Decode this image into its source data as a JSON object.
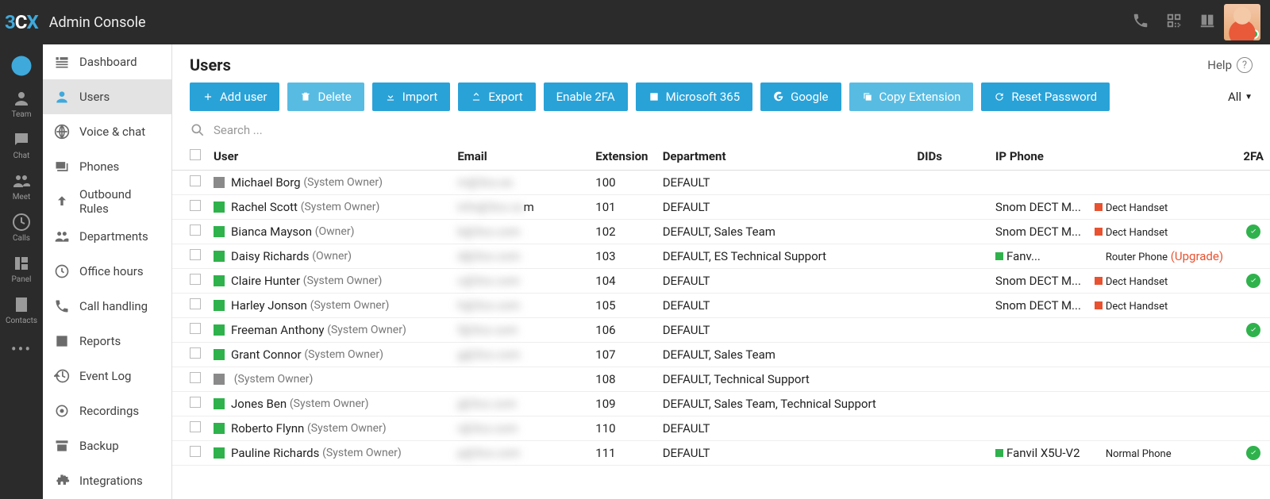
{
  "app": {
    "brand_3": "3",
    "brand_c": "C",
    "brand_x": "X",
    "title": "Admin Console"
  },
  "rail": [
    {
      "id": "chrome",
      "label": ""
    },
    {
      "id": "team",
      "label": "Team"
    },
    {
      "id": "chat",
      "label": "Chat"
    },
    {
      "id": "meet",
      "label": "Meet"
    },
    {
      "id": "calls",
      "label": "Calls"
    },
    {
      "id": "panel",
      "label": "Panel"
    },
    {
      "id": "contacts",
      "label": "Contacts"
    }
  ],
  "sidebar": [
    {
      "id": "dashboard",
      "label": "Dashboard",
      "icon": "dashboard"
    },
    {
      "id": "users",
      "label": "Users",
      "icon": "user",
      "active": true
    },
    {
      "id": "voice",
      "label": "Voice & chat",
      "icon": "globe"
    },
    {
      "id": "phones",
      "label": "Phones",
      "icon": "devices"
    },
    {
      "id": "outbound",
      "label": "Outbound Rules",
      "icon": "up"
    },
    {
      "id": "departments",
      "label": "Departments",
      "icon": "people"
    },
    {
      "id": "office",
      "label": "Office hours",
      "icon": "clock"
    },
    {
      "id": "callhandling",
      "label": "Call handling",
      "icon": "phone"
    },
    {
      "id": "reports",
      "label": "Reports",
      "icon": "report"
    },
    {
      "id": "eventlog",
      "label": "Event Log",
      "icon": "history"
    },
    {
      "id": "recordings",
      "label": "Recordings",
      "icon": "record"
    },
    {
      "id": "backup",
      "label": "Backup",
      "icon": "archive"
    },
    {
      "id": "integrations",
      "label": "Integrations",
      "icon": "puzzle"
    }
  ],
  "page": {
    "title": "Users",
    "help": "Help",
    "filter": "All"
  },
  "toolbar": {
    "add": "Add user",
    "delete": "Delete",
    "import": "Import",
    "export": "Export",
    "enable2fa": "Enable 2FA",
    "m365": "Microsoft 365",
    "google": "Google",
    "copyext": "Copy Extension",
    "resetpw": "Reset Password"
  },
  "search": {
    "placeholder": "Search ..."
  },
  "columns": {
    "user": "User",
    "email": "Email",
    "ext": "Extension",
    "dept": "Department",
    "dids": "DIDs",
    "ip": "IP Phone",
    "twofa": "2FA"
  },
  "rows": [
    {
      "status": "grey",
      "name": "Michael Borg",
      "role": "(System Owner)",
      "email": "m@3cx.ex",
      "email_vis": "",
      "ext": "100",
      "dept": "DEFAULT",
      "ip": "",
      "phone_sq": "",
      "phone_label": "",
      "upgrade": "",
      "twofa": false
    },
    {
      "status": "green",
      "name": "Rachel Scott",
      "role": "(System Owner)",
      "email": "info@3cx.co",
      "email_vis": "m",
      "ext": "101",
      "dept": "DEFAULT",
      "ip": "Snom DECT M...",
      "phone_sq": "red",
      "phone_label": "Dect Handset",
      "upgrade": "",
      "twofa": false
    },
    {
      "status": "green",
      "name": "Bianca Mayson",
      "role": "(Owner)",
      "email": "b@3cx.com",
      "email_vis": "",
      "ext": "102",
      "dept": "DEFAULT, Sales Team",
      "ip": "Snom DECT M...",
      "phone_sq": "red",
      "phone_label": "Dect Handset",
      "upgrade": "",
      "twofa": true
    },
    {
      "status": "green",
      "name": "Daisy Richards",
      "role": "(Owner)",
      "email": "d@3cx.com",
      "email_vis": "",
      "ext": "103",
      "dept": "DEFAULT, ES Technical Support",
      "ip": "Fanv...",
      "ip_sq": "green",
      "phone_sq": "",
      "phone_label": "Router Phone",
      "upgrade": "(Upgrade)",
      "twofa": false
    },
    {
      "status": "green",
      "name": "Claire Hunter",
      "role": "(System Owner)",
      "email": "c@3cx.com",
      "email_vis": "",
      "ext": "104",
      "dept": "DEFAULT",
      "ip": "Snom DECT M...",
      "phone_sq": "red",
      "phone_label": "Dect Handset",
      "upgrade": "",
      "twofa": true
    },
    {
      "status": "green",
      "name": "Harley Jonson",
      "role": "(System Owner)",
      "email": "h@3cx.com",
      "email_vis": "",
      "ext": "105",
      "dept": "DEFAULT",
      "ip": "Snom DECT M...",
      "phone_sq": "red",
      "phone_label": "Dect Handset",
      "upgrade": "",
      "twofa": false
    },
    {
      "status": "green",
      "name": "Freeman Anthony",
      "role": "(System Owner)",
      "email": "f@3cx.com",
      "email_vis": "",
      "ext": "106",
      "dept": "DEFAULT",
      "ip": "",
      "phone_sq": "",
      "phone_label": "",
      "upgrade": "",
      "twofa": true
    },
    {
      "status": "green",
      "name": "Grant Connor",
      "role": "(System Owner)",
      "email": "g@3cx.com",
      "email_vis": "",
      "ext": "107",
      "dept": "DEFAULT, Sales Team",
      "ip": "",
      "phone_sq": "",
      "phone_label": "",
      "upgrade": "",
      "twofa": false
    },
    {
      "status": "grey",
      "name": "",
      "role": "(System Owner)",
      "email": "",
      "email_vis": "",
      "ext": "108",
      "dept": "DEFAULT, Technical Support",
      "ip": "",
      "phone_sq": "",
      "phone_label": "",
      "upgrade": "",
      "twofa": false
    },
    {
      "status": "green",
      "name": "Jones Ben",
      "role": "(System Owner)",
      "email": "j@3cx.com",
      "email_vis": "",
      "ext": "109",
      "dept": "DEFAULT, Sales Team, Technical Support",
      "ip": "",
      "phone_sq": "",
      "phone_label": "",
      "upgrade": "",
      "twofa": false
    },
    {
      "status": "green",
      "name": "Roberto Flynn",
      "role": "(System Owner)",
      "email": "r@3cx.com",
      "email_vis": "",
      "ext": "110",
      "dept": "DEFAULT",
      "ip": "",
      "phone_sq": "",
      "phone_label": "",
      "upgrade": "",
      "twofa": false
    },
    {
      "status": "green",
      "name": "Pauline Richards",
      "role": "(System Owner)",
      "email": "p@3cx.com",
      "email_vis": "",
      "ext": "111",
      "dept": "DEFAULT",
      "ip": "Fanvil X5U-V2",
      "ip_sq": "green",
      "phone_sq": "",
      "phone_label": "Normal Phone",
      "upgrade": "",
      "twofa": true
    }
  ]
}
